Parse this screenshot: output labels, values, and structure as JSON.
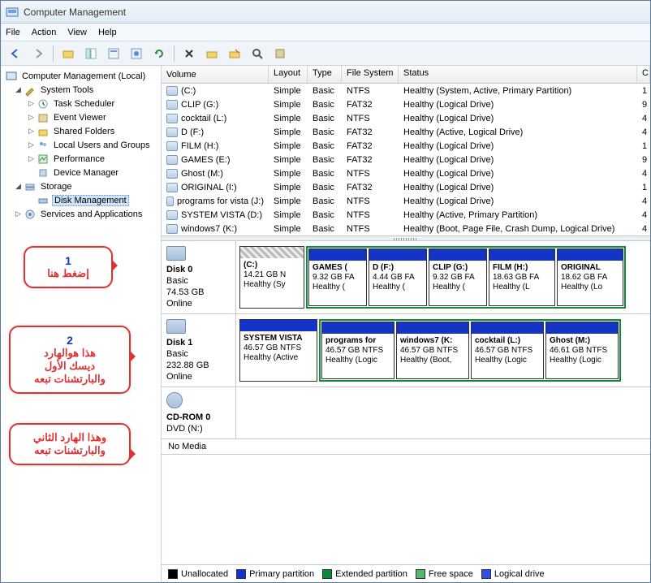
{
  "window": {
    "title": "Computer Management"
  },
  "menu": {
    "file": "File",
    "action": "Action",
    "view": "View",
    "help": "Help"
  },
  "tree": {
    "root": "Computer Management (Local)",
    "system_tools": "System Tools",
    "task_scheduler": "Task Scheduler",
    "event_viewer": "Event Viewer",
    "shared_folders": "Shared Folders",
    "local_users": "Local Users and Groups",
    "performance": "Performance",
    "device_manager": "Device Manager",
    "storage": "Storage",
    "disk_management": "Disk Management",
    "services": "Services and Applications"
  },
  "columns": {
    "volume": "Volume",
    "layout": "Layout",
    "type": "Type",
    "fs": "File System",
    "status": "Status",
    "c": "C"
  },
  "volumes": [
    {
      "name": "(C:)",
      "layout": "Simple",
      "type": "Basic",
      "fs": "NTFS",
      "status": "Healthy (System, Active, Primary Partition)",
      "c": "1"
    },
    {
      "name": "CLIP (G:)",
      "layout": "Simple",
      "type": "Basic",
      "fs": "FAT32",
      "status": "Healthy (Logical Drive)",
      "c": "9"
    },
    {
      "name": "cocktail (L:)",
      "layout": "Simple",
      "type": "Basic",
      "fs": "NTFS",
      "status": "Healthy (Logical Drive)",
      "c": "4"
    },
    {
      "name": "D (F:)",
      "layout": "Simple",
      "type": "Basic",
      "fs": "FAT32",
      "status": "Healthy (Active, Logical Drive)",
      "c": "4"
    },
    {
      "name": "FILM (H:)",
      "layout": "Simple",
      "type": "Basic",
      "fs": "FAT32",
      "status": "Healthy (Logical Drive)",
      "c": "1"
    },
    {
      "name": "GAMES (E:)",
      "layout": "Simple",
      "type": "Basic",
      "fs": "FAT32",
      "status": "Healthy (Logical Drive)",
      "c": "9"
    },
    {
      "name": "Ghost (M:)",
      "layout": "Simple",
      "type": "Basic",
      "fs": "NTFS",
      "status": "Healthy (Logical Drive)",
      "c": "4"
    },
    {
      "name": "ORIGINAL (I:)",
      "layout": "Simple",
      "type": "Basic",
      "fs": "FAT32",
      "status": "Healthy (Logical Drive)",
      "c": "1"
    },
    {
      "name": "programs for vista (J:)",
      "layout": "Simple",
      "type": "Basic",
      "fs": "NTFS",
      "status": "Healthy (Logical Drive)",
      "c": "4"
    },
    {
      "name": "SYSTEM VISTA (D:)",
      "layout": "Simple",
      "type": "Basic",
      "fs": "NTFS",
      "status": "Healthy (Active, Primary Partition)",
      "c": "4"
    },
    {
      "name": "windows7 (K:)",
      "layout": "Simple",
      "type": "Basic",
      "fs": "NTFS",
      "status": "Healthy (Boot, Page File, Crash Dump, Logical Drive)",
      "c": "4"
    }
  ],
  "disk0": {
    "name": "Disk 0",
    "type": "Basic",
    "size": "74.53 GB",
    "state": "Online",
    "p0": {
      "n": "(C:)",
      "s": "14.21 GB N",
      "h": "Healthy (Sy"
    },
    "p1": {
      "n": "GAMES (",
      "s": "9.32 GB FA",
      "h": "Healthy ("
    },
    "p2": {
      "n": "D  (F:)",
      "s": "4.44 GB FA",
      "h": "Healthy ("
    },
    "p3": {
      "n": "CLIP  (G:)",
      "s": "9.32 GB FA",
      "h": "Healthy ("
    },
    "p4": {
      "n": "FILM  (H:)",
      "s": "18.63 GB FA",
      "h": "Healthy (L"
    },
    "p5": {
      "n": "ORIGINAL",
      "s": "18.62 GB FA",
      "h": "Healthy (Lo"
    }
  },
  "disk1": {
    "name": "Disk 1",
    "type": "Basic",
    "size": "232.88 GB",
    "state": "Online",
    "p0": {
      "n": "SYSTEM VISTA",
      "s": "46.57 GB NTFS",
      "h": "Healthy (Active"
    },
    "p1": {
      "n": "programs for",
      "s": "46.57 GB NTFS",
      "h": "Healthy (Logic"
    },
    "p2": {
      "n": "windows7  (K:",
      "s": "46.57 GB NTFS",
      "h": "Healthy (Boot,"
    },
    "p3": {
      "n": "cocktail  (L:)",
      "s": "46.57 GB NTFS",
      "h": "Healthy (Logic"
    },
    "p4": {
      "n": "Ghost  (M:)",
      "s": "46.61 GB NTFS",
      "h": "Healthy (Logic"
    }
  },
  "cdrom": {
    "name": "CD-ROM 0",
    "type": "DVD (N:)",
    "nomedia": "No Media"
  },
  "legend": {
    "unalloc": "Unallocated",
    "primary": "Primary partition",
    "ext": "Extended partition",
    "free": "Free space",
    "logical": "Logical drive"
  },
  "callouts": {
    "c1": {
      "num": "1",
      "txt": "إضغط هنا"
    },
    "c2": {
      "num": "2",
      "txt": "هذا هوالهارد\nديسك الأول\nوالبارتشنات تبعه"
    },
    "c3": {
      "txt": "وهذا الهارد الثاني\nوالبارتشنات تبعه"
    }
  }
}
